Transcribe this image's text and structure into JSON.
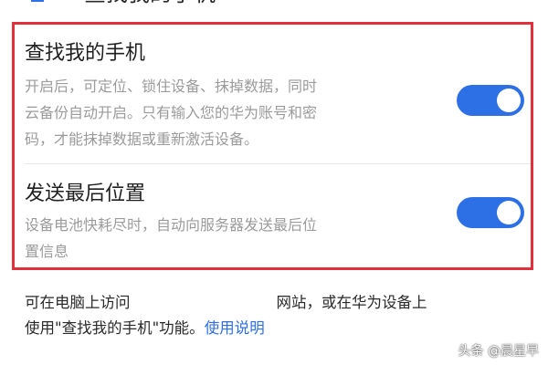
{
  "header": {
    "title": "查找我的手机"
  },
  "settings": [
    {
      "title": "查找我的手机",
      "desc_lines": [
        "开启后，可定位、锁住设备、抹掉数据，同时",
        "云备份自动开启。只有输入您的华为账号和密",
        "码，才能抹掉数据或重新激活设备。"
      ],
      "enabled": true
    },
    {
      "title": "发送最后位置",
      "desc_lines": [
        "设备电池快耗尽时，自动向服务器发送最后位",
        "置信息"
      ],
      "enabled": true
    }
  ],
  "footer": {
    "line1_part1": "可在电脑上访问",
    "line1_part2": "网站，或在华为设备上",
    "line2_text": "使用\"查找我的手机\"功能。",
    "line2_link": "使用说明"
  },
  "watermark": "头条 @晨星早",
  "colors": {
    "accent": "#2d6fe4",
    "highlight_border": "#e2303a",
    "link": "#2f6fe8"
  }
}
